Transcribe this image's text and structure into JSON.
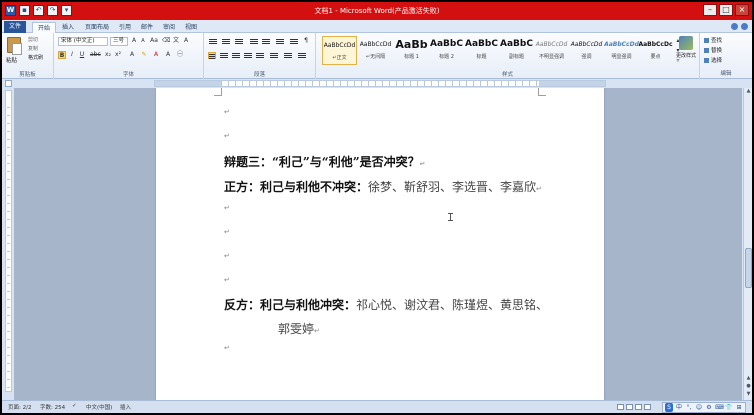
{
  "window": {
    "title": "文档1 - Microsoft Word(产品激活失败)",
    "controls": [
      "minimize",
      "maximize",
      "close"
    ]
  },
  "colors": {
    "titlebar": "#d40f0f",
    "file_tab": "#2a5699",
    "page": "#ffffff",
    "doc_background": "#a6b5ca"
  },
  "tabs": [
    "文件",
    "开始",
    "插入",
    "页面布局",
    "引用",
    "邮件",
    "审阅",
    "视图"
  ],
  "ribbon": {
    "clipboard": {
      "paste": "粘贴",
      "cut": "剪切",
      "copy": "复制",
      "format_painter": "格式刷",
      "label": "剪贴板"
    },
    "font": {
      "name": "宋体 (中文正)",
      "size": "三号",
      "label": "字体"
    },
    "paragraph": {
      "label": "段落"
    },
    "styles": {
      "label": "样式",
      "items": [
        {
          "sample": "AaBbCcDd",
          "name": "↵正文"
        },
        {
          "sample": "AaBbCcDd",
          "name": "↵无间隔"
        },
        {
          "sample": "AaBb",
          "name": "标题 1"
        },
        {
          "sample": "AaBbC",
          "name": "标题 2"
        },
        {
          "sample": "AaBbC",
          "name": "标题"
        },
        {
          "sample": "AaBbC",
          "name": "副标题"
        },
        {
          "sample": "AaBbCcDd",
          "name": "不明显强调"
        },
        {
          "sample": "AaBbCcDd",
          "name": "强调"
        },
        {
          "sample": "AaBbCcDd",
          "name": "明显强调"
        },
        {
          "sample": "AaBbCcDc",
          "name": "要点"
        }
      ],
      "change_styles": "更改样式"
    },
    "editing": {
      "label": "编辑",
      "find": "查找",
      "replace": "替换",
      "select": "选择"
    }
  },
  "document": {
    "debate_title": "辩题三：“利己”与“利他”是否冲突？",
    "pro_label": "正方：利己与利他不冲突：",
    "pro_names": "徐梦、靳舒羽、李选晋、李嘉欣",
    "con_label": "反方：利己与利他冲突：",
    "con_names_line1": "祁心悦、谢汶君、陈瑾煜、黄思铭、",
    "con_names_line2": "郭雯婷"
  },
  "statusbar": {
    "page": "页面: 2/2",
    "words": "字数: 254",
    "language": "中文(中国)",
    "mode": "插入"
  },
  "ime": [
    "中",
    "°,",
    "☺",
    "⚙",
    "⌨",
    "👕",
    "⊞"
  ]
}
